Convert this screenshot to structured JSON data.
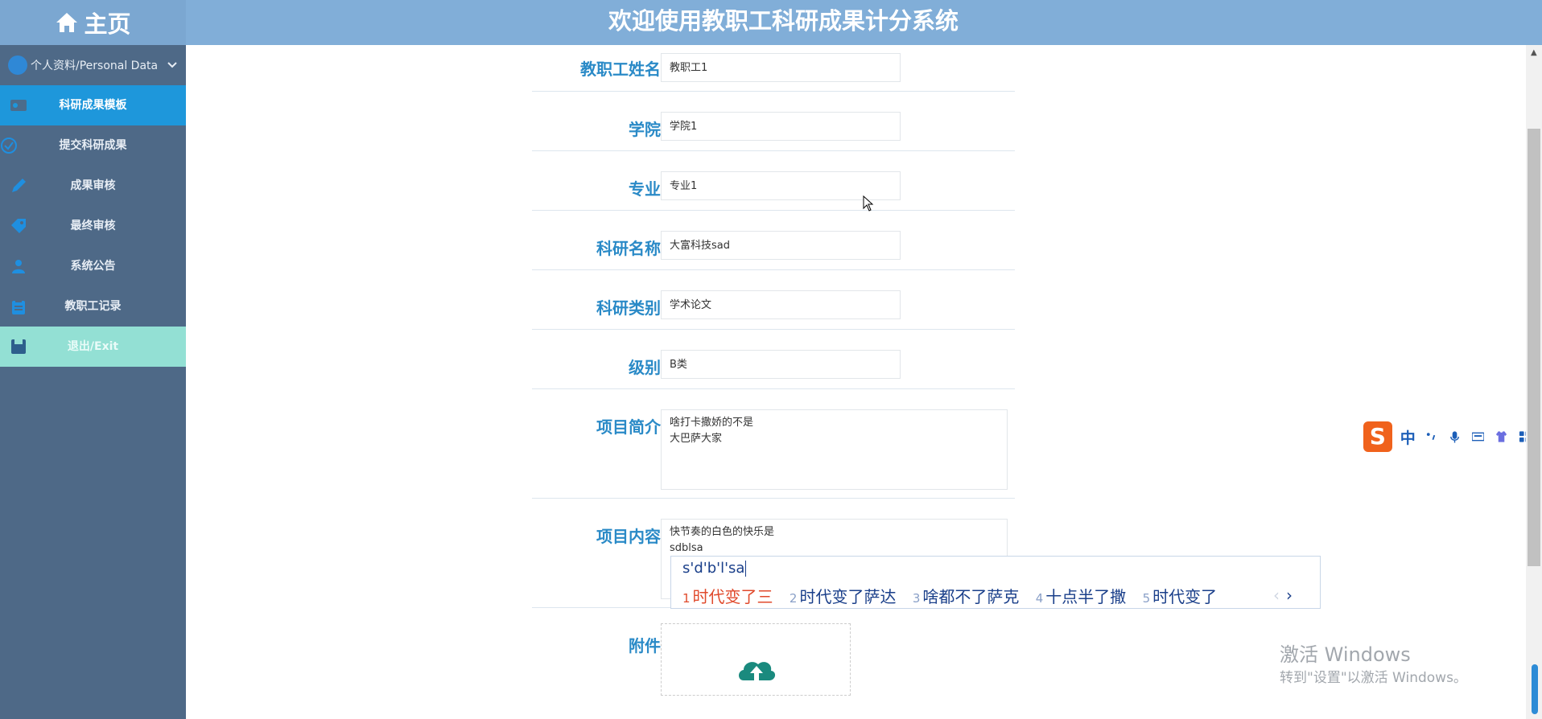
{
  "header": {
    "home": "主页",
    "title": "欢迎使用教职工科研成果计分系统"
  },
  "sidebar": {
    "head": "个人资料/Personal Data",
    "items": [
      {
        "label": "科研成果模板",
        "icon": "id-card-icon"
      },
      {
        "label": "提交科研成果",
        "icon": "check-circle-icon"
      },
      {
        "label": "成果审核",
        "icon": "edit-icon"
      },
      {
        "label": "最终审核",
        "icon": "tag-icon"
      },
      {
        "label": "系统公告",
        "icon": "users-icon"
      },
      {
        "label": "教职工记录",
        "icon": "clipboard-icon"
      },
      {
        "label": "退出/Exit",
        "icon": "save-icon"
      }
    ]
  },
  "form": {
    "name": {
      "label": "教职工姓名",
      "value": "教职工1"
    },
    "college": {
      "label": "学院",
      "value": "学院1"
    },
    "major": {
      "label": "专业",
      "value": "专业1"
    },
    "research_name": {
      "label": "科研名称",
      "value": "大富科技sad"
    },
    "category": {
      "label": "科研类别",
      "value": "学术论文"
    },
    "level": {
      "label": "级别",
      "value": "B类"
    },
    "summary": {
      "label": "项目简介",
      "value": "啥打卡撒娇的不是\n大巴萨大家"
    },
    "content": {
      "label": "项目内容",
      "value": "快节奏的白色的快乐是\nsdblsa"
    },
    "attachment": {
      "label": "附件"
    }
  },
  "ime": {
    "input": "s'd'b'l'sa",
    "candidates": [
      {
        "n": "1",
        "text": "时代变了三"
      },
      {
        "n": "2",
        "text": "时代变了萨达"
      },
      {
        "n": "3",
        "text": "啥都不了萨克"
      },
      {
        "n": "4",
        "text": "十点半了撒"
      },
      {
        "n": "5",
        "text": "时代变了"
      }
    ],
    "toolbar_lang": "中",
    "logo": "S"
  },
  "watermark": {
    "line1": "激活 Windows",
    "line2": "转到\"设置\"以激活 Windows。"
  },
  "colors": {
    "sidebar": "#4e6987",
    "active": "#1e97db",
    "exit": "#93e0d4",
    "label": "#2a8ac7",
    "topbar": "#81aed8"
  }
}
